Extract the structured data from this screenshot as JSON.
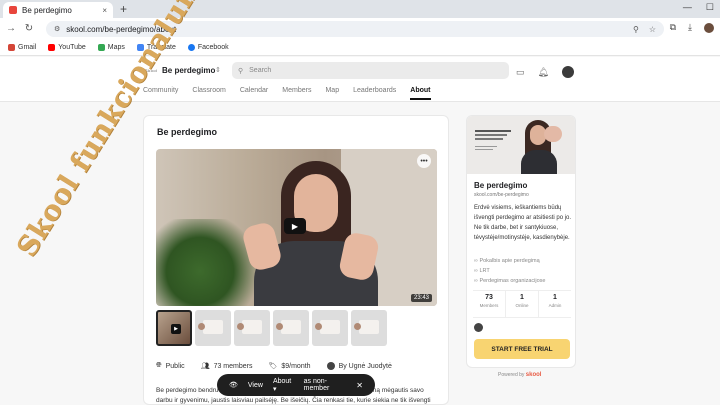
{
  "browser": {
    "tab_title": "Be perdegimo",
    "tab_close": "×",
    "new_tab": "+",
    "url": "skool.com/be-perdegimo/about",
    "bookmarks": [
      "Gmail",
      "YouTube",
      "Maps",
      "Translate",
      "Facebook"
    ]
  },
  "header": {
    "logo_small": "Skool",
    "group_name": "Be perdegimo",
    "search_placeholder": "Search",
    "nav": [
      "Community",
      "Classroom",
      "Calendar",
      "Members",
      "Map",
      "Leaderboards",
      "About"
    ],
    "active_nav": "About"
  },
  "main": {
    "title": "Be perdegimo",
    "video_duration": "23:43",
    "meta": {
      "privacy": "Public",
      "members": "73 members",
      "price": "$9/month",
      "author": "By Ugnė Juodytė"
    },
    "description": "Be perdegimo bendruomenė skirta visiems, ieškantiems būdų kiekvieną dieną mėgautis savo darbu ir gyvenimu, jaustis laisviau pailsėję. Be išeičių. Čia renkasi tie, kurie siekia ne tik išvengti perdegimo,"
  },
  "floatbar": {
    "view": "View",
    "about": "About",
    "as": "as non-member"
  },
  "side": {
    "title": "Be perdegimo",
    "url": "skool.com/be-perdegimo",
    "description": "Erdvė visiems, ieškantiems būdų išvengti perdegimo ar atsitiesti po jo. Ne tik darbe, bet ir santykiuose, tėvystėje/motinystėje, kasdienybėje.",
    "links": [
      "Pokalbis apie perdegimą",
      "LRT",
      "Perdegimas organizacijose"
    ],
    "stats": [
      {
        "value": "73",
        "label": "Members"
      },
      {
        "value": "1",
        "label": "Online"
      },
      {
        "value": "1",
        "label": "Admin"
      }
    ],
    "cta": "START FREE TRIAL",
    "powered_by": "Powered by",
    "powered_brand": "skool"
  },
  "overlay": "Skool funkcionalumas"
}
